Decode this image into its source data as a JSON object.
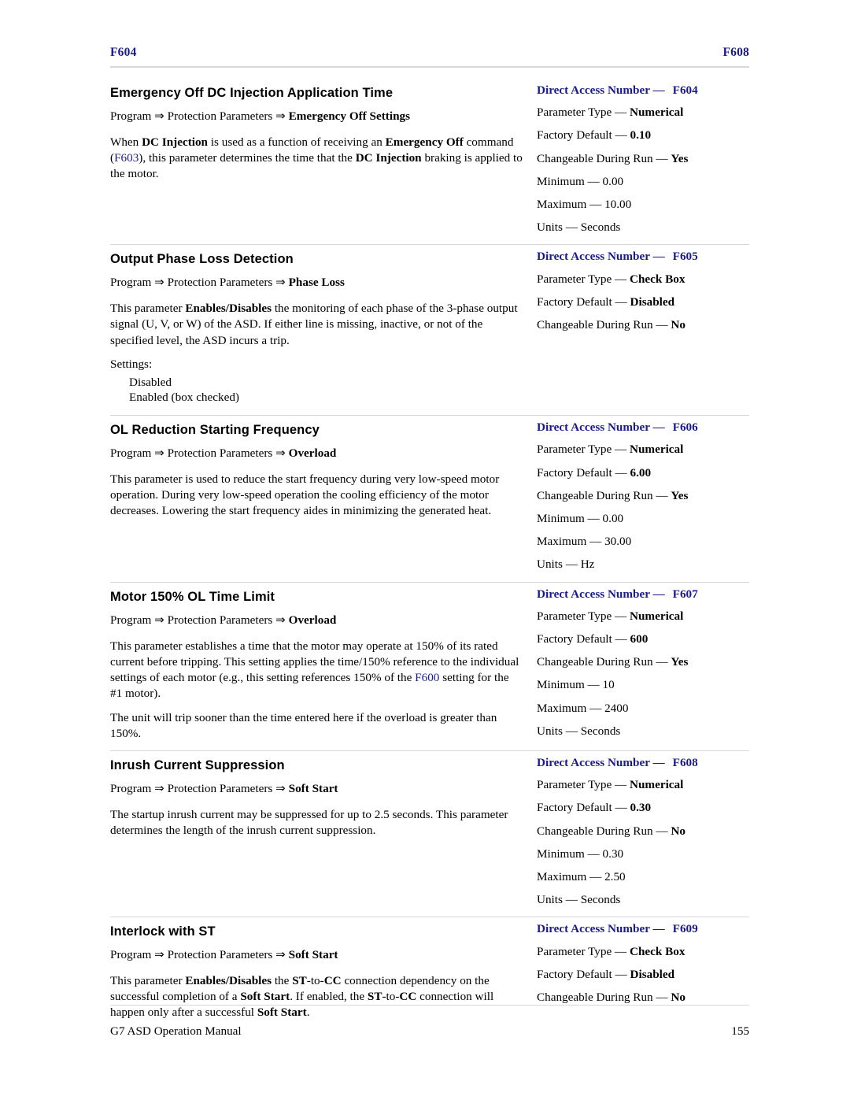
{
  "header": {
    "left": "F604",
    "right": "F608"
  },
  "footer": {
    "left": "G7 ASD Operation Manual",
    "right": "155"
  },
  "labels": {
    "direct_access": "Direct Access Number —",
    "parameter_type": "Parameter Type —",
    "factory_default": "Factory Default —",
    "changeable": "Changeable During Run —",
    "minimum": "Minimum —",
    "maximum": "Maximum —",
    "units": "Units —",
    "settings": "Settings:"
  },
  "entries": [
    {
      "title": "Emergency Off DC Injection Application Time",
      "path_prefix": "Program ⇒ Protection Parameters ⇒ ",
      "path_bold": "Emergency Off Settings",
      "paragraphs": [
        "When DC Injection is used as a function of receiving an Emergency Off command (F603), this parameter determines the time that the DC Injection braking is applied to the motor."
      ],
      "direct_access": "F604",
      "parameter_type": "Numerical",
      "factory_default": "0.10",
      "changeable": "Yes",
      "minimum": "0.00",
      "maximum": "10.00",
      "units": "Seconds"
    },
    {
      "title": "Output Phase Loss Detection",
      "path_prefix": "Program ⇒ Protection Parameters ⇒ ",
      "path_bold": "Phase Loss",
      "paragraphs": [
        "This parameter Enables/Disables the monitoring of each phase of the 3-phase output signal (U, V, or W) of the ASD. If either line is missing, inactive, or not of the specified level, the ASD incurs a trip."
      ],
      "settings_label": "Settings:",
      "settings": [
        "Disabled",
        "Enabled (box checked)"
      ],
      "direct_access": "F605",
      "parameter_type": "Check Box",
      "factory_default": "Disabled",
      "changeable": "No"
    },
    {
      "title": "OL Reduction Starting Frequency",
      "path_prefix": "Program ⇒ Protection Parameters ⇒ ",
      "path_bold": "Overload",
      "paragraphs": [
        "This parameter is used to reduce the start frequency during very low-speed motor operation. During very low-speed operation the cooling efficiency of the motor decreases. Lowering the start frequency aides in minimizing the generated heat."
      ],
      "direct_access": "F606",
      "parameter_type": "Numerical",
      "factory_default": "6.00",
      "changeable": "Yes",
      "minimum": "0.00",
      "maximum": "30.00",
      "units": "Hz"
    },
    {
      "title": "Motor 150% OL Time Limit",
      "path_prefix": "Program ⇒ Protection Parameters ⇒ ",
      "path_bold": "Overload",
      "paragraphs": [
        "This parameter establishes a time that the motor may operate at 150% of its rated current before tripping. This setting applies the time/150% reference to the individual settings of each motor (e.g., this setting references 150% of the F600 setting for the #1 motor).",
        "The unit will trip sooner than the time entered here if the overload is greater than 150%."
      ],
      "direct_access": "F607",
      "parameter_type": "Numerical",
      "factory_default": "600",
      "changeable": "Yes",
      "minimum": "10",
      "maximum": "2400",
      "units": "Seconds"
    },
    {
      "title": "Inrush Current Suppression",
      "path_prefix": "Program ⇒ Protection Parameters ⇒ ",
      "path_bold": "Soft Start",
      "paragraphs": [
        "The startup inrush current may be suppressed for up to 2.5 seconds. This parameter determines the length of the inrush current suppression."
      ],
      "direct_access": "F608",
      "parameter_type": "Numerical",
      "factory_default": "0.30",
      "changeable": "No",
      "minimum": "0.30",
      "maximum": "2.50",
      "units": "Seconds"
    },
    {
      "title": "Interlock with ST",
      "path_prefix": "Program ⇒ Protection Parameters ⇒ ",
      "path_bold": "Soft Start",
      "paragraphs": [
        "This parameter Enables/Disables the ST-to-CC connection dependency on the successful completion of a Soft Start. If enabled, the ST-to-CC connection will happen only after a successful Soft Start."
      ],
      "direct_access": "F609",
      "parameter_type": "Check Box",
      "factory_default": "Disabled",
      "changeable": "No"
    }
  ]
}
